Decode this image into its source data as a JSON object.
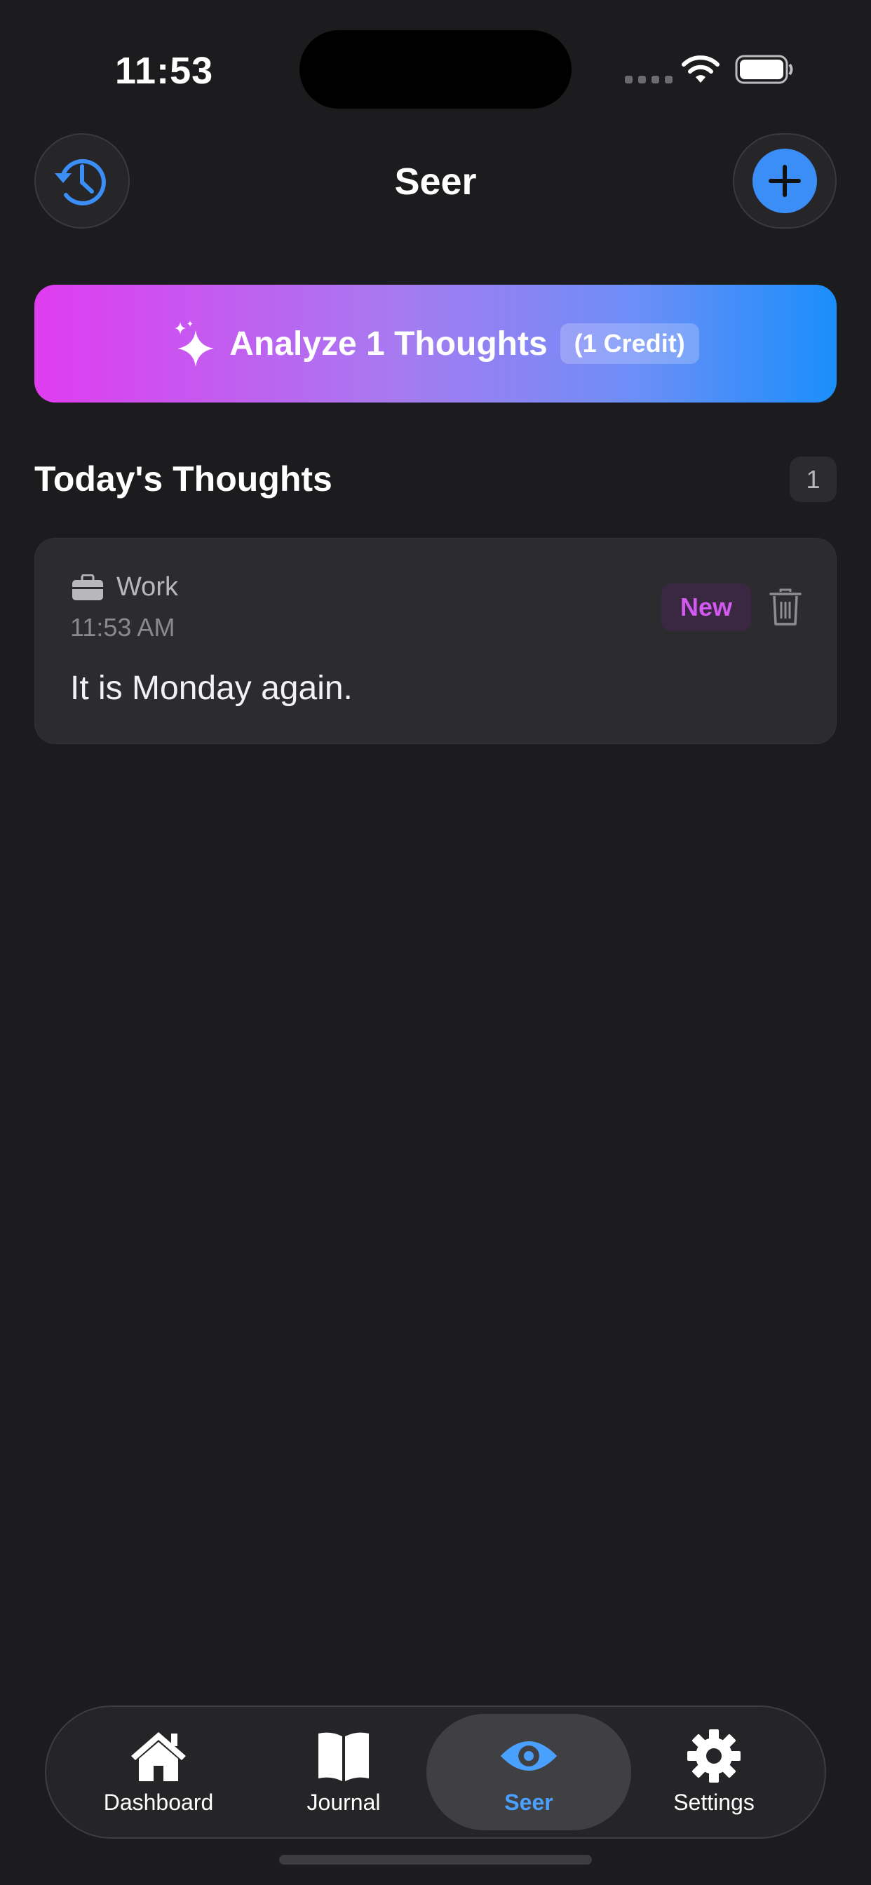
{
  "status_bar": {
    "time": "11:53"
  },
  "header": {
    "title": "Seer"
  },
  "analyze": {
    "label": "Analyze 1 Thoughts",
    "credit": "(1 Credit)"
  },
  "section": {
    "title": "Today's Thoughts",
    "count": "1"
  },
  "thought": {
    "category": "Work",
    "time": "11:53 AM",
    "badge": "New",
    "text": "It is Monday again."
  },
  "tabs": [
    {
      "label": "Dashboard",
      "icon": "house-icon"
    },
    {
      "label": "Journal",
      "icon": "book-icon"
    },
    {
      "label": "Seer",
      "icon": "eye-icon",
      "active": true
    },
    {
      "label": "Settings",
      "icon": "gear-icon"
    }
  ],
  "colors": {
    "accent": "#3a8ef6",
    "active_tab": "#4aa0ff",
    "badge_text": "#d35af0",
    "gradient_start": "#e03cf0",
    "gradient_end": "#1a8efb"
  }
}
